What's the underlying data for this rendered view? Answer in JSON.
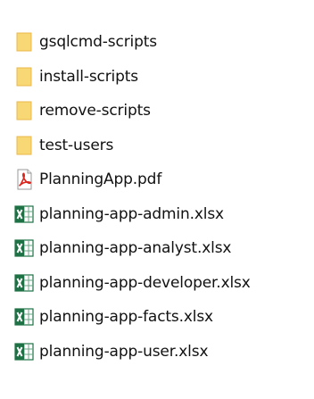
{
  "files": [
    {
      "name": "gsqlcmd-scripts",
      "type": "folder",
      "icon": "folder-icon"
    },
    {
      "name": "install-scripts",
      "type": "folder",
      "icon": "folder-icon"
    },
    {
      "name": "remove-scripts",
      "type": "folder",
      "icon": "folder-icon"
    },
    {
      "name": "test-users",
      "type": "folder",
      "icon": "folder-icon"
    },
    {
      "name": "PlanningApp.pdf",
      "type": "pdf",
      "icon": "pdf-file-icon"
    },
    {
      "name": "planning-app-admin.xlsx",
      "type": "xlsx",
      "icon": "excel-file-icon"
    },
    {
      "name": "planning-app-analyst.xlsx",
      "type": "xlsx",
      "icon": "excel-file-icon"
    },
    {
      "name": "planning-app-developer.xlsx",
      "type": "xlsx",
      "icon": "excel-file-icon"
    },
    {
      "name": "planning-app-facts.xlsx",
      "type": "xlsx",
      "icon": "excel-file-icon"
    },
    {
      "name": "planning-app-user.xlsx",
      "type": "xlsx",
      "icon": "excel-file-icon"
    }
  ],
  "colors": {
    "folder": "#F8D775",
    "folder_dark": "#E8B849",
    "pdf_red": "#D9251C",
    "excel_green": "#1E7145",
    "text": "#111111"
  }
}
